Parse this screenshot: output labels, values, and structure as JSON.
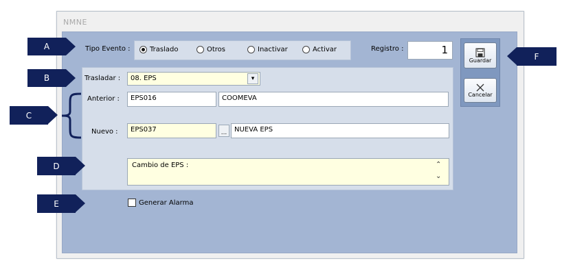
{
  "window": {
    "title": "NMNE"
  },
  "tipo_evento": {
    "label": "Tipo Evento :",
    "options": [
      {
        "label": "Traslado",
        "selected": true
      },
      {
        "label": "Otros",
        "selected": false
      },
      {
        "label": "Inactivar",
        "selected": false
      },
      {
        "label": "Activar",
        "selected": false
      }
    ]
  },
  "registro": {
    "label": "Registro :",
    "value": "1"
  },
  "trasladar": {
    "label": "Trasladar :",
    "value": "08. EPS"
  },
  "anterior": {
    "label": "Anterior :",
    "code": "EPS016",
    "name": "COOMEVA"
  },
  "nuevo": {
    "label": "Nuevo :",
    "code": "EPS037",
    "lookup_label": "...",
    "name": "NUEVA EPS"
  },
  "notes": {
    "value": "Cambio de EPS :"
  },
  "alarm": {
    "label": "Generar Alarma",
    "checked": false
  },
  "buttons": {
    "save": "Guardar",
    "cancel": "Cancelar"
  },
  "callouts": {
    "a": "A",
    "b": "B",
    "c": "C",
    "d": "D",
    "e": "E",
    "f": "F"
  },
  "colors": {
    "callout": "#11215a",
    "client": "#a3b5d3",
    "group": "#d6deea",
    "input_yellow": "#ffffe1"
  }
}
